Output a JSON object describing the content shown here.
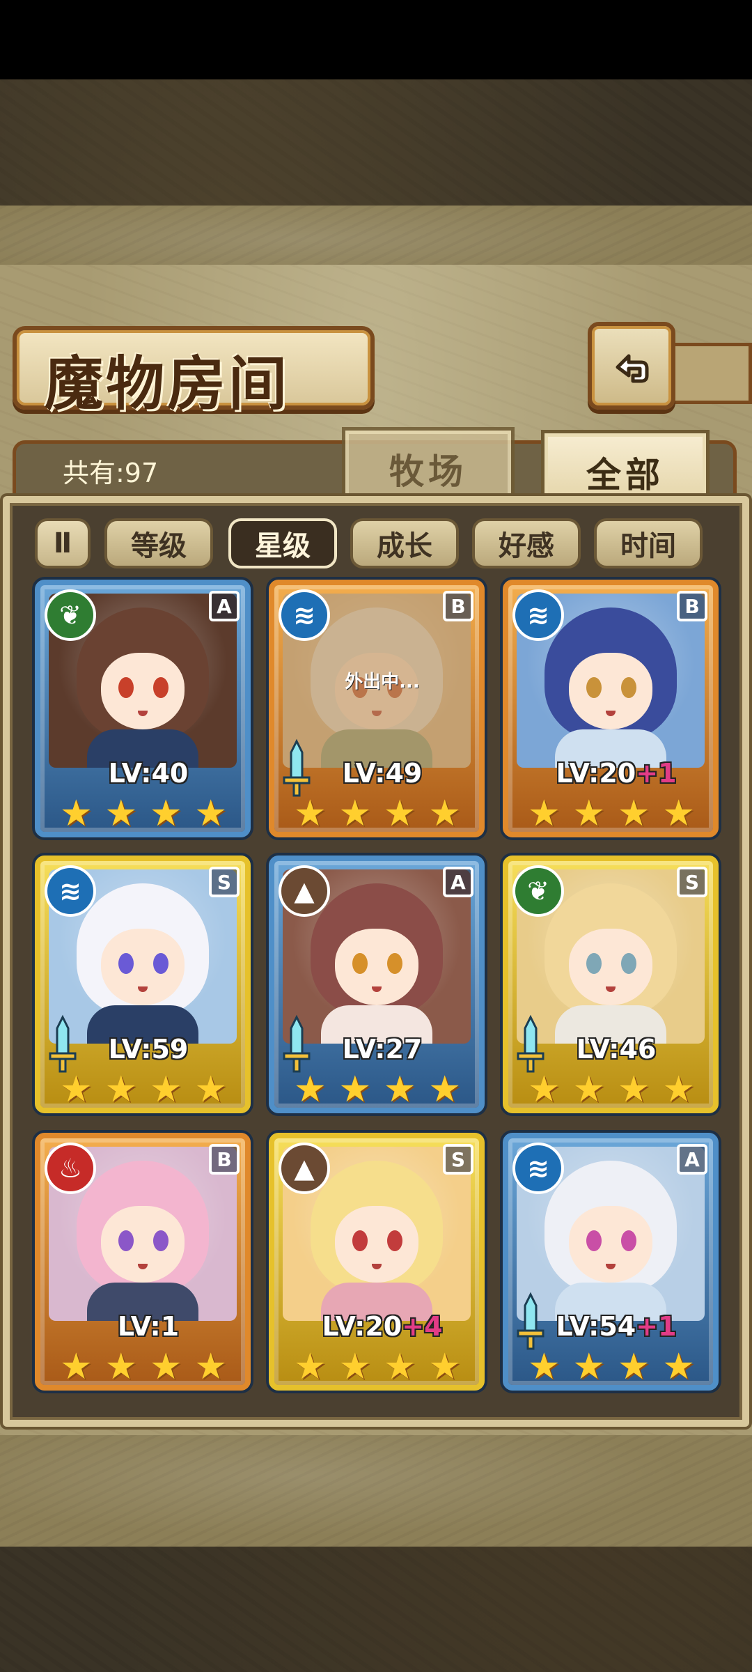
{
  "header": {
    "title": "魔物房间",
    "back_icon": "return-arrow-icon"
  },
  "summary": {
    "count_label": "共有:97"
  },
  "tabs": [
    {
      "label": "牧场",
      "active": false
    },
    {
      "label": "全部",
      "active": true
    }
  ],
  "sort": {
    "toggle_label": "Ⅱ",
    "options": [
      {
        "label": "等级",
        "active": false
      },
      {
        "label": "星级",
        "active": true
      },
      {
        "label": "成长",
        "active": false
      },
      {
        "label": "好感",
        "active": false
      },
      {
        "label": "时间",
        "active": false
      }
    ]
  },
  "element_colors": {
    "grass": "#2f7d32",
    "water": "#1e6fb5",
    "fire": "#c62b28",
    "earth": "#6b4a33"
  },
  "cards": [
    {
      "rank": "A",
      "element": "grass",
      "element_icon": "leaf-icon",
      "level": "LV:40",
      "plus": "",
      "stars": 4,
      "weapon": false,
      "away": ""
    },
    {
      "rank": "B",
      "element": "water",
      "element_icon": "water-wave-icon",
      "level": "LV:49",
      "plus": "",
      "stars": 4,
      "weapon": true,
      "away": "外出中..."
    },
    {
      "rank": "B",
      "element": "water",
      "element_icon": "water-wave-icon",
      "level": "LV:20",
      "plus": "+1",
      "stars": 4,
      "weapon": false,
      "away": ""
    },
    {
      "rank": "S",
      "element": "water",
      "element_icon": "water-wave-icon",
      "level": "LV:59",
      "plus": "",
      "stars": 4,
      "weapon": true,
      "away": ""
    },
    {
      "rank": "A",
      "element": "earth",
      "element_icon": "mountain-icon",
      "level": "LV:27",
      "plus": "",
      "stars": 4,
      "weapon": true,
      "away": ""
    },
    {
      "rank": "S",
      "element": "grass",
      "element_icon": "leaf-icon",
      "level": "LV:46",
      "plus": "",
      "stars": 4,
      "weapon": true,
      "away": ""
    },
    {
      "rank": "B",
      "element": "fire",
      "element_icon": "flame-icon",
      "level": "LV:1",
      "plus": "",
      "stars": 4,
      "weapon": false,
      "away": ""
    },
    {
      "rank": "S",
      "element": "earth",
      "element_icon": "mountain-icon",
      "level": "LV:20",
      "plus": "+4",
      "stars": 4,
      "weapon": false,
      "away": ""
    },
    {
      "rank": "A",
      "element": "water",
      "element_icon": "water-wave-icon",
      "level": "LV:54",
      "plus": "+1",
      "stars": 4,
      "weapon": true,
      "away": ""
    }
  ]
}
